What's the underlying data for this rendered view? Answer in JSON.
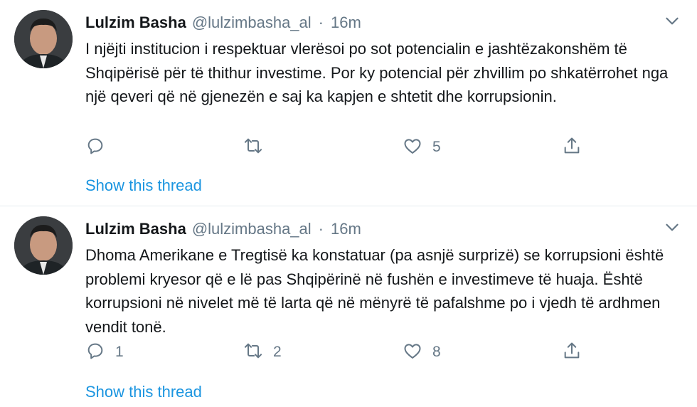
{
  "tweets": [
    {
      "author_name": "Lulzim Basha",
      "handle": "@lulzimbasha_al",
      "separator": "·",
      "time": "16m",
      "text": "I njëjti institucion i respektuar vlerësoi po sot potencialin e jashtëzakonshëm të Shqipërisë për të thithur investime. Por ky potencial për zhvillim po shkatërrohet nga një qeveri që në gjenezën e saj ka kapjen e shtetit dhe korrupsionin.",
      "reply_count": "",
      "retweet_count": "",
      "like_count": "5",
      "show_thread": "Show this thread"
    },
    {
      "author_name": "Lulzim Basha",
      "handle": "@lulzimbasha_al",
      "separator": "·",
      "time": "16m",
      "text": "Dhoma Amerikane e Tregtisë ka konstatuar (pa asnjë surprizë) se korrupsioni është problemi kryesor që e lë pas Shqipërinë në fushën e investimeve të huaja. Është korrupsioni në nivelet më të larta që në mënyrë të pafalshme po i vjedh të ardhmen vendit tonë.",
      "reply_count": "1",
      "retweet_count": "2",
      "like_count": "8",
      "show_thread": "Show this thread"
    }
  ],
  "colors": {
    "text": "#14171a",
    "secondary": "#657786",
    "link": "#1b95e0",
    "divider": "#e6ecf0"
  },
  "icons": [
    "chevron-down-icon",
    "reply-icon",
    "retweet-icon",
    "like-icon",
    "share-icon"
  ]
}
